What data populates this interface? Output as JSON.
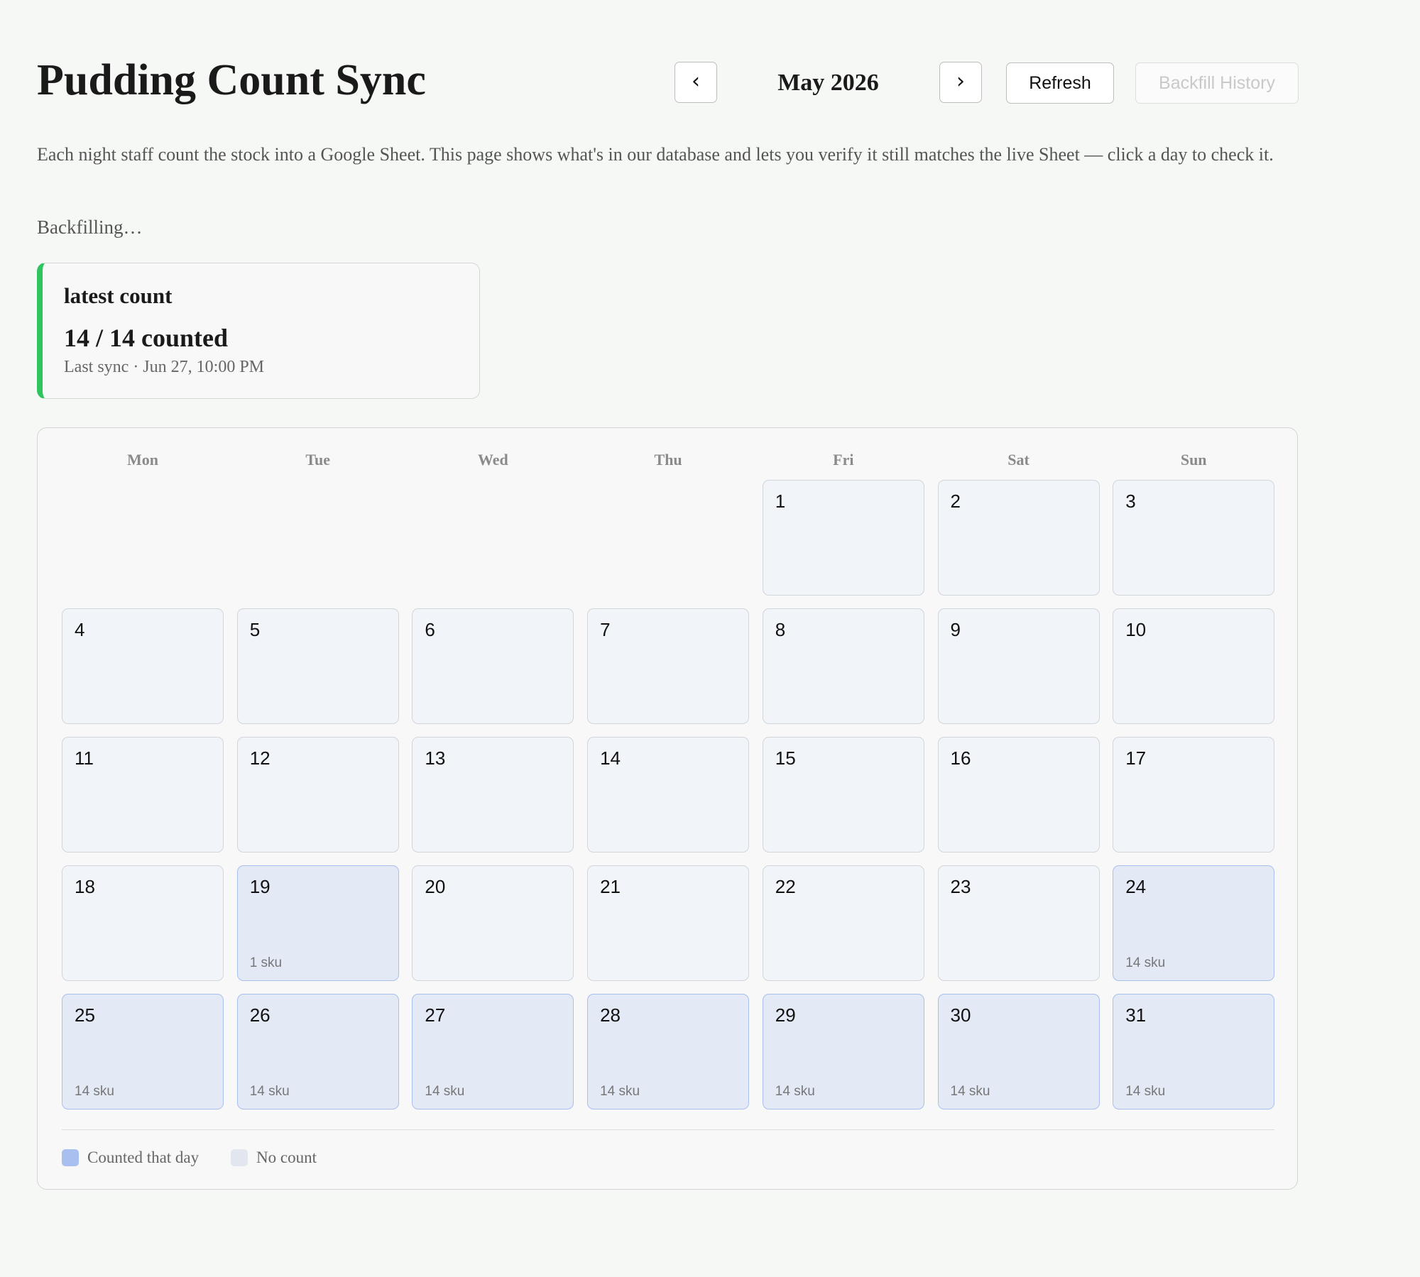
{
  "header": {
    "title": "Pudding Count Sync",
    "prev_label": "‹",
    "month_label": "May 2026",
    "next_label": "›",
    "refresh_label": "Refresh",
    "backfill_label": "Backfill History"
  },
  "description": "Each night staff count the stock into a Google Sheet. This page shows what's in our database and lets you verify it still matches the live Sheet — click a day to check it.",
  "status_text": "Backfilling…",
  "latest": {
    "label": "latest count",
    "value": "14 / 14 counted",
    "last_sync": "Last sync · Jun 27, 10:00 PM",
    "accent_color": "#2ec45e"
  },
  "calendar": {
    "weekdays": [
      "Mon",
      "Tue",
      "Wed",
      "Thu",
      "Fri",
      "Sat",
      "Sun"
    ],
    "first_weekday_index": 4,
    "days": [
      {
        "day": "1",
        "sku": ""
      },
      {
        "day": "2",
        "sku": ""
      },
      {
        "day": "3",
        "sku": ""
      },
      {
        "day": "4",
        "sku": ""
      },
      {
        "day": "5",
        "sku": ""
      },
      {
        "day": "6",
        "sku": ""
      },
      {
        "day": "7",
        "sku": ""
      },
      {
        "day": "8",
        "sku": ""
      },
      {
        "day": "9",
        "sku": ""
      },
      {
        "day": "10",
        "sku": ""
      },
      {
        "day": "11",
        "sku": ""
      },
      {
        "day": "12",
        "sku": ""
      },
      {
        "day": "13",
        "sku": ""
      },
      {
        "day": "14",
        "sku": ""
      },
      {
        "day": "15",
        "sku": ""
      },
      {
        "day": "16",
        "sku": ""
      },
      {
        "day": "17",
        "sku": ""
      },
      {
        "day": "18",
        "sku": ""
      },
      {
        "day": "19",
        "sku": "1 sku"
      },
      {
        "day": "20",
        "sku": ""
      },
      {
        "day": "21",
        "sku": ""
      },
      {
        "day": "22",
        "sku": ""
      },
      {
        "day": "23",
        "sku": ""
      },
      {
        "day": "24",
        "sku": "14 sku"
      },
      {
        "day": "25",
        "sku": "14 sku"
      },
      {
        "day": "26",
        "sku": "14 sku"
      },
      {
        "day": "27",
        "sku": "14 sku"
      },
      {
        "day": "28",
        "sku": "14 sku"
      },
      {
        "day": "29",
        "sku": "14 sku"
      },
      {
        "day": "30",
        "sku": "14 sku"
      },
      {
        "day": "31",
        "sku": "14 sku"
      }
    ]
  },
  "legend": [
    {
      "label": "Counted that day",
      "color": "#a9bff0"
    },
    {
      "label": "No count",
      "color": "#e2e7ef"
    }
  ]
}
